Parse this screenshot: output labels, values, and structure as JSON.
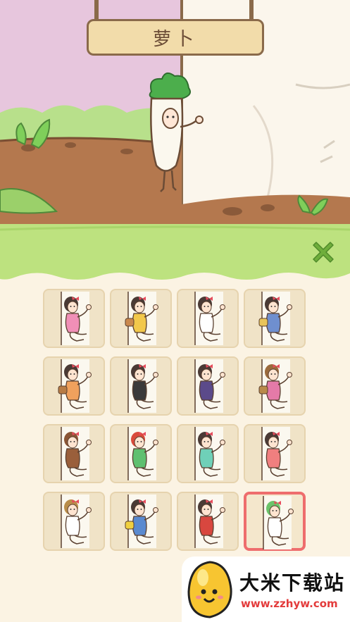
{
  "sign": {
    "title": "萝卜"
  },
  "close_icon": "close-icon",
  "costumes": [
    {
      "name": "pink-dress",
      "dress": "#f08fb7",
      "hair": "#4a3a35",
      "bag": "",
      "selected": false
    },
    {
      "name": "yellow-dress-backpack",
      "dress": "#f2c84b",
      "hair": "#4a3a35",
      "bag": "#c9884d",
      "selected": false
    },
    {
      "name": "white-shirt-shorts",
      "dress": "#ffffff",
      "hair": "#4a3a35",
      "bag": "",
      "selected": false
    },
    {
      "name": "blue-dress-purse",
      "dress": "#6f8fcf",
      "hair": "#4a3a35",
      "bag": "#e8c45a",
      "selected": false
    },
    {
      "name": "orange-dress-basket",
      "dress": "#f0a15d",
      "hair": "#4a3a35",
      "bag": "#b77b45",
      "selected": false
    },
    {
      "name": "black-outfit-glasses",
      "dress": "#3a3a3a",
      "hair": "#4a3a35",
      "bag": "",
      "selected": false
    },
    {
      "name": "purple-ninja",
      "dress": "#5b4a8a",
      "hair": "#4a3a35",
      "bag": "",
      "selected": false
    },
    {
      "name": "farmer-with-basket",
      "dress": "#e47aa8",
      "hair": "#9a6a3d",
      "bag": "#b98a4b",
      "selected": false
    },
    {
      "name": "monkey-costume",
      "dress": "#9a5f3b",
      "hair": "#8a5535",
      "bag": "",
      "selected": false
    },
    {
      "name": "green-dress-beret",
      "dress": "#5fc070",
      "hair": "#d94a3a",
      "bag": "",
      "selected": false
    },
    {
      "name": "teal-dress",
      "dress": "#6fd0b8",
      "hair": "#4a3a35",
      "bag": "",
      "selected": false
    },
    {
      "name": "pink-qipao",
      "dress": "#f07f7f",
      "hair": "#4a3a35",
      "bag": "",
      "selected": false
    },
    {
      "name": "white-dress-sunhat",
      "dress": "#ffffff",
      "hair": "#b98d4a",
      "bag": "",
      "selected": false
    },
    {
      "name": "blue-swimsuit-pineapple",
      "dress": "#5a8ad0",
      "hair": "#4a3a35",
      "bag": "#f0d040",
      "selected": false
    },
    {
      "name": "red-qipao",
      "dress": "#d8473f",
      "hair": "#4a3a35",
      "bag": "",
      "selected": false
    },
    {
      "name": "radish-costume",
      "dress": "#ffffff",
      "hair": "#6cc36a",
      "bag": "",
      "selected": true
    }
  ],
  "watermark": {
    "title": "大米下载站",
    "url": "www.zzhyw.com"
  }
}
